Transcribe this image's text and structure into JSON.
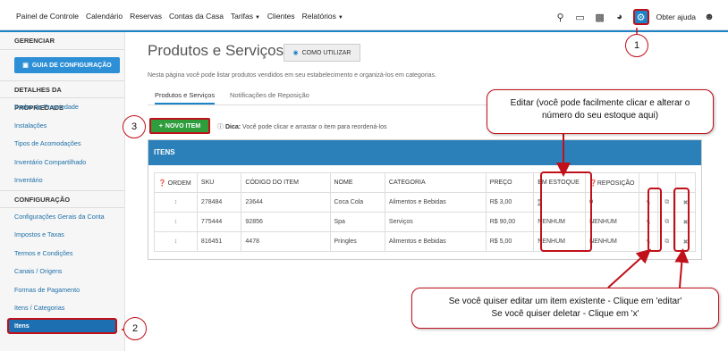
{
  "topnav": {
    "items": [
      "Painel de Controle",
      "Calendário",
      "Reservas",
      "Contas da Casa",
      "Tarifas",
      "Clientes",
      "Relatórios"
    ],
    "help": "Obter ajuda"
  },
  "sidebar": {
    "manage_header": "GERENCIAR",
    "guide_button": "GUIA DE CONFIGURAÇÃO",
    "property_header": "DETALHES DA PROPRIEDADE",
    "property_items": [
      "Dados da Propriedade",
      "Instalações",
      "Tipos de Acomodações",
      "Inventário Compartilhado",
      "Inventário"
    ],
    "config_header": "CONFIGURAÇÃO",
    "config_items": [
      "Configurações Gerais da Conta",
      "Impostos e Taxas",
      "Termos e Condições",
      "Canais / Origens",
      "Formas de Pagamento",
      "Itens / Categorias"
    ],
    "active_item": "Itens"
  },
  "main": {
    "title": "Produtos e Serviços",
    "how_button": "COMO UTILIZAR",
    "description": "Nesta página você pode listar produtos vendidos em seu estabelecimento e organizá-los em categorias.",
    "tabs": [
      "Produtos e Serviços",
      "Notificações de Reposição"
    ],
    "new_item_button": "NOVO ITEM",
    "tip_label": "Dica:",
    "tip_text": "Você pode clicar e arrastar o item para reordená-los",
    "panel_title": "ITENS",
    "columns": [
      "ORDEM",
      "SKU",
      "CÓDIGO DO ITEM",
      "NOME",
      "CATEGORIA",
      "PREÇO",
      "EM ESTOQUE",
      "REPOSIÇÃO"
    ],
    "rows": [
      {
        "sku": "278484",
        "code": "23644",
        "name": "Coca Cola",
        "category": "Alimentos e Bebidas",
        "price": "R$ 3,00",
        "stock": "5",
        "restock": "0"
      },
      {
        "sku": "775444",
        "code": "92856",
        "name": "Spa",
        "category": "Serviços",
        "price": "R$ 90,00",
        "stock": "NENHUM",
        "restock": "NENHUM"
      },
      {
        "sku": "816451",
        "code": "4478",
        "name": "Pringles",
        "category": "Alimentos e Bebidas",
        "price": "R$ 5,00",
        "stock": "NENHUM",
        "restock": "NENHUM"
      }
    ]
  },
  "callouts": {
    "edit_stock": "Editar (você pode facilmente clicar e alterar o número do seu estoque aqui)",
    "edit_delete_line1": "Se você quiser editar um item existente - Clique em 'editar'",
    "edit_delete_line2": "Se você quiser deletar - Clique em 'x'",
    "num1": "1",
    "num2": "2",
    "num3": "3"
  },
  "colors": {
    "accent": "#1c83c6",
    "annotation": "#c0101a",
    "success": "#2e9e3d"
  }
}
